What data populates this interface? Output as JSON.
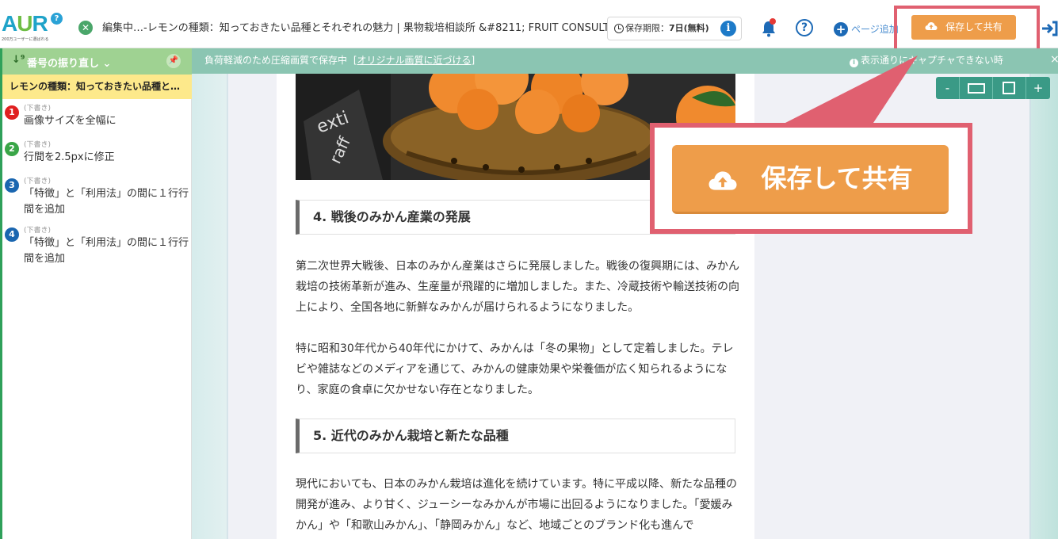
{
  "header": {
    "logo_text": "AUR",
    "logo_sub": "200万ユーザーに選ばれる",
    "title": "編集中…‐レモンの種類：知っておきたい品種とそれぞれの魅力 | 果物栽培相談所 &#8211; FRUIT CONSULTING &",
    "deadline_label": "保存期限：",
    "deadline_value": "7日(無料)",
    "page_add_label": "ページ追加",
    "save_share_label": "保存して共有"
  },
  "subbar": {
    "compress_message": "負荷軽減のため圧縮画質で保存中",
    "original_link": "[オリジナル画質に近づける]",
    "capture_warning": "表示通りにキャプチャできない時"
  },
  "sidebar": {
    "renumber_label": "番号の振り直し",
    "document_title": "レモンの種類：知っておきたい品種と…",
    "history": [
      {
        "number": "1",
        "status": "(下書き)",
        "text": "画像サイズを全幅に",
        "color": "#e02020"
      },
      {
        "number": "2",
        "status": "(下書き)",
        "text": "行間を2.5pxに修正",
        "color": "#3aa648"
      },
      {
        "number": "3",
        "status": "(下書き)",
        "text": "「特徴」と「利用法」の間に１行行間を追加",
        "color": "#1a66b0"
      },
      {
        "number": "4",
        "status": "(下書き)",
        "text": "「特徴」と「利用法」の間に１行行間を追加",
        "color": "#1a66b0"
      }
    ]
  },
  "article": {
    "heading4": "4. 戦後のみかん産業の発展",
    "para1": "第二次世界大戦後、日本のみかん産業はさらに発展しました。戦後の復興期には、みかん栽培の技術革新が進み、生産量が飛躍的に増加しました。また、冷蔵技術や輸送技術の向上により、全国各地に新鮮なみかんが届けられるようになりました。",
    "para2": "特に昭和30年代から40年代にかけて、みかんは「冬の果物」として定着しました。テレビや雑誌などのメディアを通じて、みかんの健康効果や栄養価が広く知られるようになり、家庭の食卓に欠かせない存在となりました。",
    "heading5": "5. 近代のみかん栽培と新たな品種",
    "para3": "現代においても、日本のみかん栽培は進化を続けています。特に平成以降、新たな品種の開発が進み、より甘く、ジューシーなみかんが市場に出回るようになりました。「愛媛みかん」や「和歌山みかん」、「静岡みかん」など、地域ごとのブランド化も進んで"
  },
  "zoom": {
    "minus": "-",
    "plus": "+"
  },
  "callout": {
    "save_share_label": "保存して共有"
  },
  "colors": {
    "accent_orange": "#ee9d4a",
    "highlight_red": "#e06070",
    "subbar_green": "#8bc5b2",
    "sidebar_head_green": "#9fd292",
    "doc_yellow": "#fde98b"
  }
}
